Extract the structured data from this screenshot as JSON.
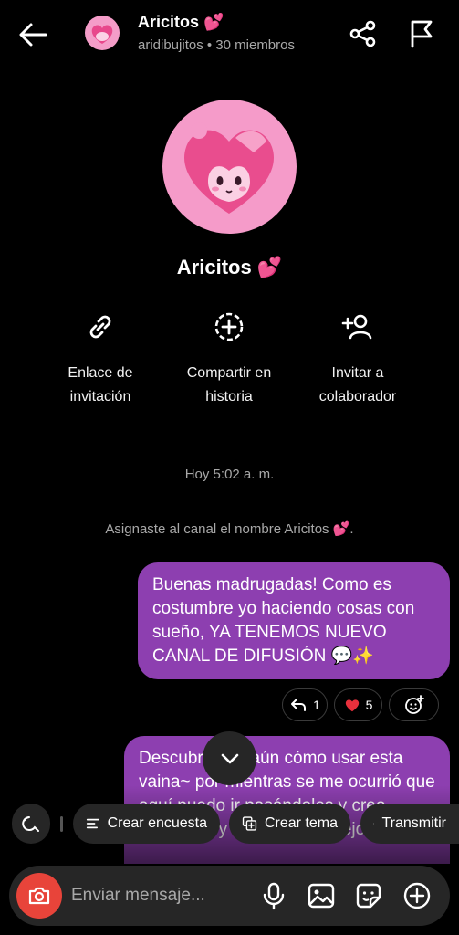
{
  "header": {
    "title": "Aricitos 💕",
    "subtitle": "aridibujitos • 30 miembros"
  },
  "channel": {
    "name": "Aricitos 💕"
  },
  "actions": [
    {
      "label": "Enlace de\ninvitación",
      "icon": "link-icon"
    },
    {
      "label": "Compartir en\nhistoria",
      "icon": "add-story-icon"
    },
    {
      "label": "Invitar a\ncolaborador",
      "icon": "add-person-icon"
    }
  ],
  "chat": {
    "timestamp": "Hoy 5:02 a. m.",
    "system_message": "Asignaste al canal el nombre Aricitos 💕.",
    "messages": [
      {
        "text": "Buenas madrugadas! Como es costumbre yo haciendo cosas con sueño, YA TENEMOS NUEVO CANAL DE DIFUSIÓN 💬✨"
      },
      {
        "text": "Descubriendo aún cómo usar esta vaina~ por mientras se me ocurrió que aquí puedo ir pasándoles y creo contenido y como me manejo"
      }
    ],
    "reactions": [
      {
        "icon": "reply-icon",
        "count": "1"
      },
      {
        "icon": "heart-icon",
        "count": "5"
      },
      {
        "icon": "add-reaction-icon",
        "count": ""
      }
    ]
  },
  "quick_actions": [
    {
      "label": "Crear encuesta",
      "icon": "poll-icon"
    },
    {
      "label": "Crear tema",
      "icon": "topic-icon"
    },
    {
      "label": "Transmitir",
      "icon": "broadcast-icon"
    }
  ],
  "composer": {
    "placeholder": "Enviar mensaje..."
  },
  "colors": {
    "bubble": "#8d3fb0",
    "accent_pink": "#f59bc9",
    "camera": "#e8443a"
  }
}
